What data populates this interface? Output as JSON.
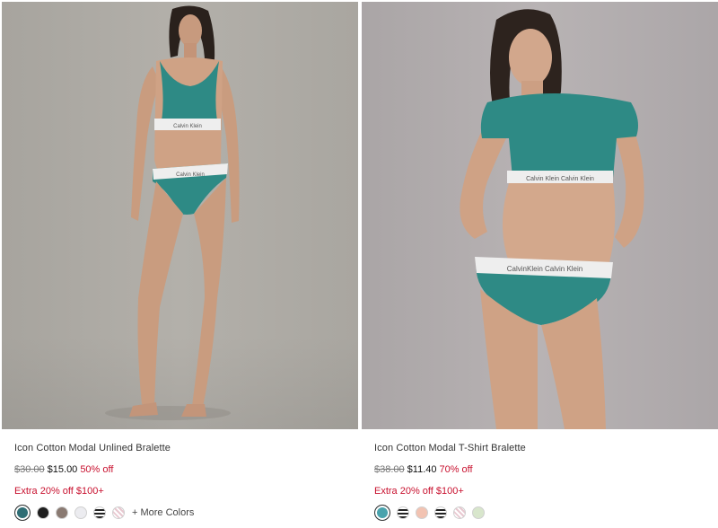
{
  "products": [
    {
      "name": "Icon Cotton Modal Unlined Bralette",
      "original_price": "$30.00",
      "sale_price": "$15.00",
      "discount": "50% off",
      "promo": "Extra 20% off $100+",
      "swatches": [
        {
          "color": "#2f6e75",
          "selected": true
        },
        {
          "color": "#1e1e1e",
          "selected": false
        },
        {
          "color": "#8a7a72",
          "selected": false
        },
        {
          "color": "#ececf0",
          "selected": false
        },
        {
          "color": "stripe",
          "selected": false
        },
        {
          "color": "stripe-light",
          "selected": false
        }
      ],
      "more_colors": "+ More Colors"
    },
    {
      "name": "Icon Cotton Modal T-Shirt Bralette",
      "original_price": "$38.00",
      "sale_price": "$11.40",
      "discount": "70% off",
      "promo": "Extra 20% off $100+",
      "swatches": [
        {
          "color": "#4aa3ad",
          "selected": true
        },
        {
          "color": "stripe",
          "selected": false
        },
        {
          "color": "#f2c3b2",
          "selected": false
        },
        {
          "color": "stripe",
          "selected": false
        },
        {
          "color": "stripe-light",
          "selected": false
        },
        {
          "color": "#d8e6cc",
          "selected": false
        }
      ]
    }
  ],
  "colors": {
    "sale_red": "#c8102e",
    "teal_garment": "#2e8a85",
    "waistband": "#eeeeee"
  }
}
